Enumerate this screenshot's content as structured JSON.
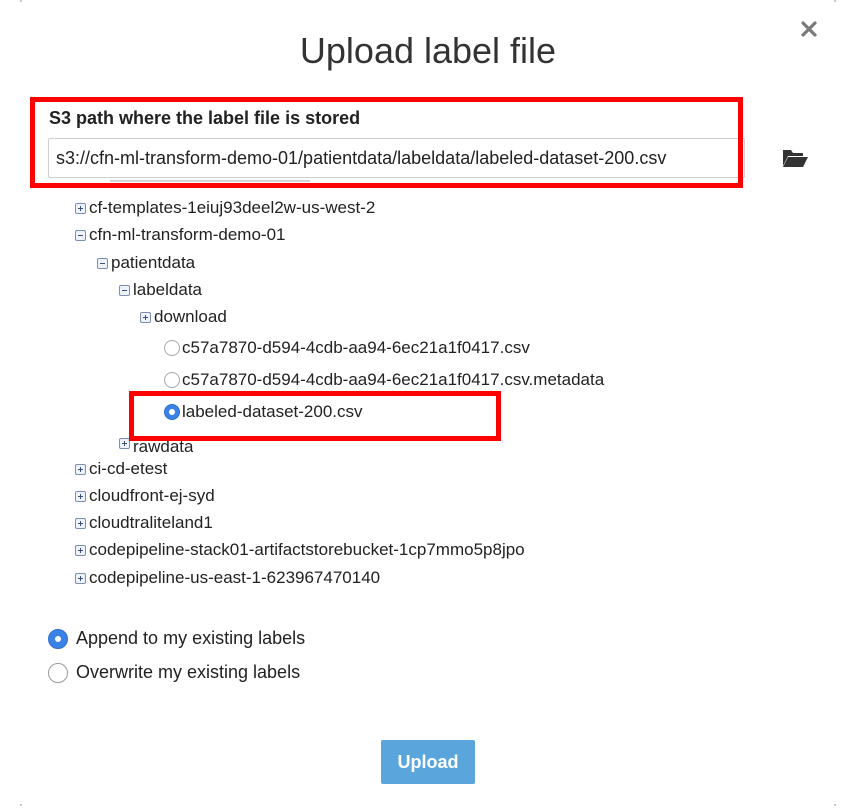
{
  "dialog": {
    "title": "Upload label file",
    "close_icon": "close-icon"
  },
  "path_field": {
    "label": "S3 path where the label file is stored",
    "value": "s3://cfn-ml-transform-demo-01/patientdata/labeldata/labeled-dataset-200.csv",
    "browse_icon": "folder-open-icon"
  },
  "tree": {
    "items": [
      {
        "label": "cf-templates-1eiuj93deel2w-us-west-2",
        "type": "folder",
        "state": "collapsed"
      },
      {
        "label": "cfn-ml-transform-demo-01",
        "type": "folder",
        "state": "expanded"
      },
      {
        "label": "patientdata",
        "type": "folder",
        "state": "expanded"
      },
      {
        "label": "labeldata",
        "type": "folder",
        "state": "expanded"
      },
      {
        "label": "download",
        "type": "folder",
        "state": "collapsed"
      },
      {
        "label": "c57a7870-d594-4cdb-aa94-6ec21a1f0417.csv",
        "type": "file",
        "selected": false
      },
      {
        "label": "c57a7870-d594-4cdb-aa94-6ec21a1f0417.csv.metadata",
        "type": "file",
        "selected": false
      },
      {
        "label": "labeled-dataset-200.csv",
        "type": "file",
        "selected": true
      },
      {
        "label": "rawdata",
        "type": "folder",
        "state": "collapsed"
      },
      {
        "label": "ci-cd-etest",
        "type": "folder",
        "state": "collapsed"
      },
      {
        "label": "cloudfront-ej-syd",
        "type": "folder",
        "state": "collapsed"
      },
      {
        "label": "cloudtraliteland1",
        "type": "folder",
        "state": "collapsed"
      },
      {
        "label": "codepipeline-stack01-artifactstorebucket-1cp7mmo5p8jpo",
        "type": "folder",
        "state": "collapsed"
      },
      {
        "label": "codepipeline-us-east-1-623967470140",
        "type": "folder",
        "state": "collapsed"
      }
    ]
  },
  "options": {
    "append_label": "Append to my existing labels",
    "append_selected": true,
    "overwrite_label": "Overwrite my existing labels",
    "overwrite_selected": false
  },
  "actions": {
    "upload_label": "Upload"
  },
  "colors": {
    "highlight": "#ff0000",
    "primary_button": "#5aa6dc",
    "radio_selected": "#3b82e6"
  }
}
